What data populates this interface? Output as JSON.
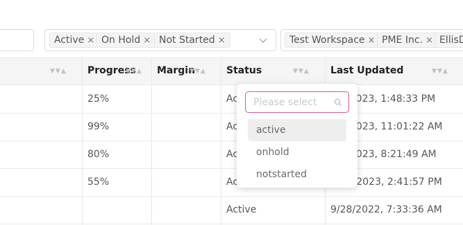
{
  "filters": {
    "status_tags": [
      "Active",
      "On Hold",
      "Not Started"
    ],
    "workspace_tags": [
      "Test Workspace",
      "PME Inc.",
      "EllisD"
    ]
  },
  "table": {
    "headers": {
      "progress": "Progress",
      "margin": "Margin",
      "status": "Status",
      "last_updated": "Last Updated"
    },
    "rows": [
      {
        "progress": "25%",
        "status": "Ac",
        "last_updated": "/2023, 1:48:33 PM"
      },
      {
        "progress": "99%",
        "status": "Ac",
        "last_updated": "2023, 11:01:22 AM"
      },
      {
        "progress": "80%",
        "status": "Ac",
        "last_updated": "2023, 8:21:49 AM"
      },
      {
        "progress": "55%",
        "status": "Activ",
        "last_updated": "/7/2023, 2:41:57 PM"
      },
      {
        "progress": "",
        "status": "Active",
        "last_updated": "9/28/2022, 7:33:36 AM"
      }
    ]
  },
  "status_dropdown": {
    "placeholder": "Please select",
    "options": [
      "active",
      "onhold",
      "notstarted"
    ]
  },
  "icons": {
    "tag_remove": "close-icon",
    "dropdown_arrow": "chevron-down-icon",
    "sort": "sort-filter-icon",
    "search": "search-icon"
  },
  "colors": {
    "accent": "#e1558f",
    "header_bg": "#f5f5f5",
    "selected_option_bg": "#eeeeee"
  }
}
